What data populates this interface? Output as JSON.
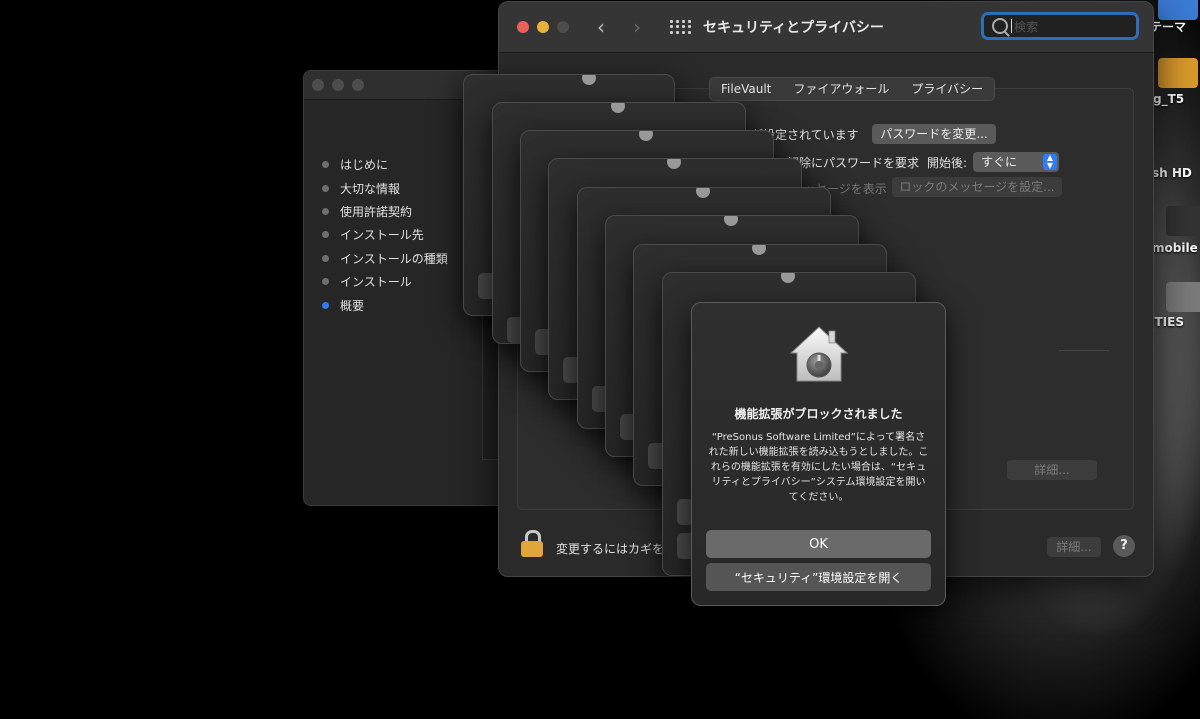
{
  "desktop": {
    "labels": [
      "テーマ",
      "g_T5",
      "sh HD",
      "mobile",
      "ITIES"
    ]
  },
  "installer": {
    "steps": [
      {
        "label": "はじめに",
        "current": false
      },
      {
        "label": "大切な情報",
        "current": false
      },
      {
        "label": "使用許諾契約",
        "current": false
      },
      {
        "label": "インストール先",
        "current": false
      },
      {
        "label": "インストールの種類",
        "current": false
      },
      {
        "label": "インストール",
        "current": false
      },
      {
        "label": "概要",
        "current": true
      }
    ]
  },
  "sysprefs": {
    "title": "セキュリティとプライバシー",
    "search_placeholder": "検索",
    "tabs": [
      "FileVault",
      "ファイアウォール",
      "プライバシー"
    ],
    "password_set_text": "が設定されています",
    "change_password_button": "パスワードを変更...",
    "require_password_text": "の解除にパスワードを要求",
    "start_after_label": "開始後:",
    "start_after_value": "すぐに",
    "lock_message_text": "ッセージを表示",
    "set_lock_message_button": "ロックのメッセージを設定...",
    "details_button_1": "詳細...",
    "details_button_2": "詳細...",
    "lock_text": "変更するにはカギを",
    "help_label": "?"
  },
  "alert": {
    "heading": "機能拡張がブロックされました",
    "message": "“PreSonus Software Limited”によって署名された新しい機能拡張を読み込もうとしました。これらの機能拡張を有効にしたい場合は、“セキュリティとプライバシー”システム環境設定を開いてください。",
    "ok_button": "OK",
    "open_button": "“セキュリティ”環境設定を開く"
  },
  "colors": {
    "accent": "#2f7cf6",
    "close": "#ec5f57",
    "minimize": "#e6b23a",
    "zoom": "#4d4d4d",
    "lock": "#e0a63b"
  }
}
